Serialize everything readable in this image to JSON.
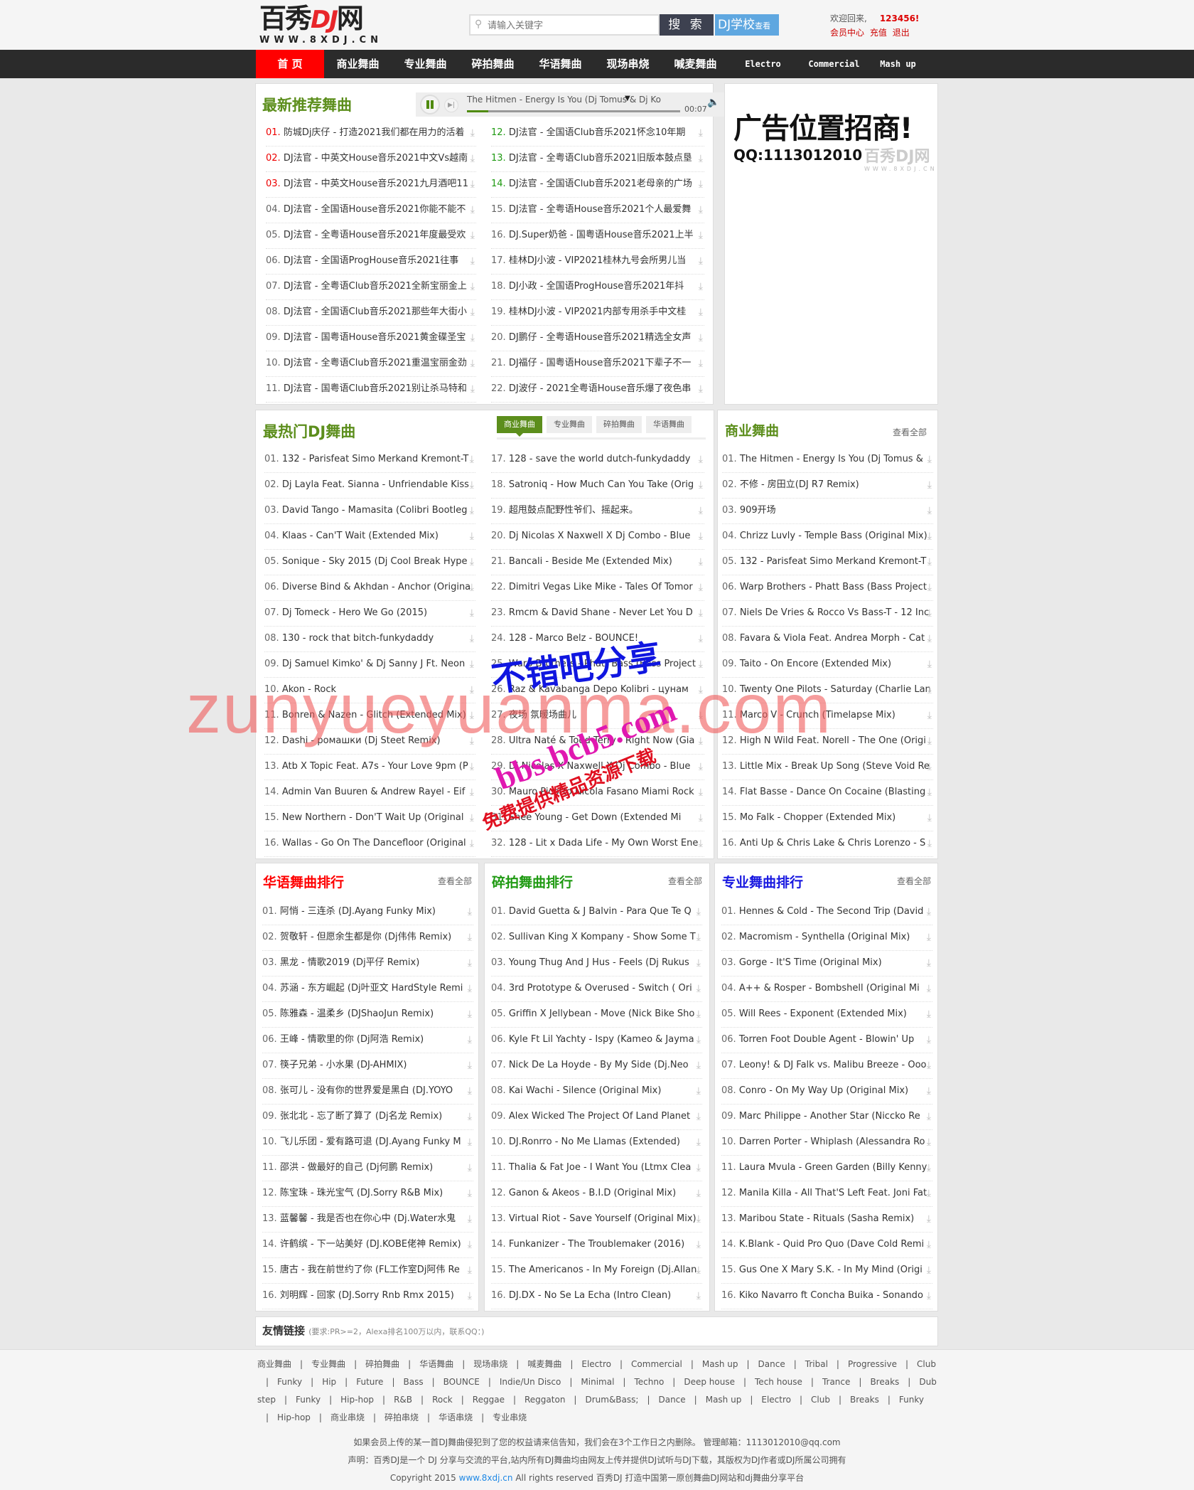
{
  "header": {
    "logo_cn": "百秀",
    "logo_dj": "DJ",
    "logo_net": "网",
    "logo_url": "WWW.8XDJ.CN",
    "search_placeholder": "请输入关键字",
    "search_button": "搜 索",
    "dj_school": "DJ学校",
    "dj_school_view": "查看",
    "welcome": "欢迎回来,",
    "username": "123456!",
    "member_center": "会员中心",
    "recharge": "充值",
    "logout": "退出"
  },
  "nav": [
    "首 页",
    "商业舞曲",
    "专业舞曲",
    "碎拍舞曲",
    "华语舞曲",
    "现场串烧",
    "喊麦舞曲",
    "Electro",
    "Commercial",
    "Mash up"
  ],
  "latest": {
    "title": "最新推荐舞曲",
    "player": {
      "track": "The Hitmen - Energy Is You (Dj Tomus & Dj Ko",
      "time": "00:07",
      "progress": 0.1
    },
    "left": [
      {
        "n": "01.",
        "t": "防城Dj庆仔 - 打造2021我们都在用力的活着"
      },
      {
        "n": "02.",
        "t": "DJ法官 - 中英文House音乐2021中文Vs越南"
      },
      {
        "n": "03.",
        "t": "DJ法官 - 中英文House音乐2021九月酒吧11"
      },
      {
        "n": "04.",
        "t": "DJ法官 - 全国语House音乐2021你能不能不"
      },
      {
        "n": "05.",
        "t": "DJ法官 - 全粤语House音乐2021年度最受欢"
      },
      {
        "n": "06.",
        "t": "DJ法官 - 全国语ProgHouse音乐2021往事"
      },
      {
        "n": "07.",
        "t": "DJ法官 - 全粤语Club音乐2021全新宝丽金上"
      },
      {
        "n": "08.",
        "t": "DJ法官 - 全国语Club音乐2021那些年大街小"
      },
      {
        "n": "09.",
        "t": "DJ法官 - 国粤语House音乐2021黄金碟圣宝"
      },
      {
        "n": "10.",
        "t": "DJ法官 - 全粤语Club音乐2021重温宝丽金劲"
      },
      {
        "n": "11.",
        "t": "DJ法官 - 国粤语Club音乐2021别让杀马特和"
      }
    ],
    "right": [
      {
        "n": "12.",
        "t": "DJ法官 - 全国语Club音乐2021怀念10年期"
      },
      {
        "n": "13.",
        "t": "DJ法官 - 全粤语Club音乐2021旧版本鼓点垦"
      },
      {
        "n": "14.",
        "t": "DJ法官 - 全国语Club音乐2021老母亲的广场"
      },
      {
        "n": "15.",
        "t": "DJ法官 - 全粤语House音乐2021个人最爱舞"
      },
      {
        "n": "16.",
        "t": "DJ.Super奶爸 - 国粤语House音乐2021上半"
      },
      {
        "n": "17.",
        "t": "桂林DJ小波 - VIP2021桂林九号会所男儿当"
      },
      {
        "n": "18.",
        "t": "DJ小政 - 全国语ProgHouse音乐2021年抖"
      },
      {
        "n": "19.",
        "t": "桂林DJ小波 - VIP2021内部专用杀手中文桂"
      },
      {
        "n": "20.",
        "t": "DJ鹏仔 - 全粤语House音乐2021精选全女声"
      },
      {
        "n": "21.",
        "t": "DJ福仔 - 国粤语House音乐2021下辈子不一"
      },
      {
        "n": "22.",
        "t": "DJ波仔 - 2021全粤语House音乐爆了夜色串"
      }
    ]
  },
  "ad": {
    "headline": "广告位置招商!",
    "qq": "QQ:1113012010",
    "brand": "百秀DJ网",
    "brand_url": "WWW.8XDJ.CN"
  },
  "hot": {
    "title": "最热门DJ舞曲",
    "tabs": [
      "商业舞曲",
      "专业舞曲",
      "碎拍舞曲",
      "华语舞曲"
    ],
    "left": [
      {
        "n": "01.",
        "t": "132 - Parisfeat Simo Merkand Kremont-T"
      },
      {
        "n": "02.",
        "t": "Dj Layla Feat. Sianna - Unfriendable Kiss"
      },
      {
        "n": "03.",
        "t": "David Tango - Mamasita (Colibri Bootleg"
      },
      {
        "n": "04.",
        "t": "Klaas - Can'T Wait (Extended Mix)"
      },
      {
        "n": "05.",
        "t": "Sonique - Sky 2015 (Dj Cool Break Hype"
      },
      {
        "n": "06.",
        "t": "Diverse Bind & Akhdan - Anchor (Origina"
      },
      {
        "n": "07.",
        "t": "Dj Tomeck - Hero We Go (2015)"
      },
      {
        "n": "08.",
        "t": "130 - rock that bitch-funkydaddy"
      },
      {
        "n": "09.",
        "t": "Dj Samuel Kimko' & Dj Sanny J Ft. Neon"
      },
      {
        "n": "10.",
        "t": "Akon - Rock"
      },
      {
        "n": "11.",
        "t": "Bonren & Nazen - Glitch (Extended Mix)"
      },
      {
        "n": "12.",
        "t": "Dashi - ромашки (Dj Steet Remix)"
      },
      {
        "n": "13.",
        "t": "Atb X Topic Feat. A7s - Your Love 9pm (P"
      },
      {
        "n": "14.",
        "t": "Admin Van Buuren & Andrew Rayel - Eif"
      },
      {
        "n": "15.",
        "t": "New Northern - Don'T Wait Up (Original"
      },
      {
        "n": "16.",
        "t": "Wallas - Go On The Dancefloor (Original"
      }
    ],
    "right": [
      {
        "n": "17.",
        "t": "128 - save the world dutch-funkydaddy"
      },
      {
        "n": "18.",
        "t": "Satroniq - How Much Can You Take (Orig"
      },
      {
        "n": "19.",
        "t": "超甩鼓点配野性爷们、摇起来。"
      },
      {
        "n": "20.",
        "t": "Dj Nicolas X Naxwell X Dj Combo - Blue"
      },
      {
        "n": "21.",
        "t": "Bancali - Beside Me (Extended Mix)"
      },
      {
        "n": "22.",
        "t": "Dimitri Vegas Like Mike - Tales Of Tomor"
      },
      {
        "n": "23.",
        "t": "Rmcm & David Shane - Never Let You D"
      },
      {
        "n": "24.",
        "t": "128 - Marco Belz - BOUNCE!"
      },
      {
        "n": "25.",
        "t": "Warp Brothers - Phatt Bass (Bass Project"
      },
      {
        "n": "26.",
        "t": "Raz & Kavabanga Depo Kolibri - цунам"
      },
      {
        "n": "27.",
        "t": "夜场 氛暖场曲儿"
      },
      {
        "n": "28.",
        "t": "Ultra Naté & Todd Terry - Right Now (Gia"
      },
      {
        "n": "29.",
        "t": "Dj Nicolas X Naxwell X Dj Combo - Blue"
      },
      {
        "n": "30.",
        "t": "Mauro Picotto Nicola Fasano Miami Rock"
      },
      {
        "n": "31.",
        "t": "Shee Young - Get Down (Extended Mi"
      },
      {
        "n": "32.",
        "t": "128 - Lit x Dada Life - My Own Worst Ene"
      }
    ]
  },
  "commercial": {
    "title": "商业舞曲",
    "view_all": "查看全部",
    "items": [
      {
        "n": "01.",
        "t": "The Hitmen - Energy Is You (Dj Tomus &"
      },
      {
        "n": "02.",
        "t": "不修 - 房田立(DJ R7 Remix)"
      },
      {
        "n": "03.",
        "t": "909开场"
      },
      {
        "n": "04.",
        "t": "Chrizz Luvly - Temple Bass (Original Mix)"
      },
      {
        "n": "05.",
        "t": "132 - Parisfeat Simo Merkand Kremont-T"
      },
      {
        "n": "06.",
        "t": "Warp Brothers - Phatt Bass (Bass Project"
      },
      {
        "n": "07.",
        "t": "Niels De Vries & Rocco Vs Bass-T - 12 Inc"
      },
      {
        "n": "08.",
        "t": "Favara & Viola Feat. Andrea Morph - Cat"
      },
      {
        "n": "09.",
        "t": "Taito - On Encore (Extended Mix)"
      },
      {
        "n": "10.",
        "t": "Twenty One Pilots - Saturday (Charlie Lan"
      },
      {
        "n": "11.",
        "t": "Marco V - Crunch (Timelapse Mix)"
      },
      {
        "n": "12.",
        "t": "High N Wild Feat. Norell - The One (Origi"
      },
      {
        "n": "13.",
        "t": "Little Mix - Break Up Song (Steve Void Re"
      },
      {
        "n": "14.",
        "t": "Flat Basse - Dance On Cocaine (Blasting"
      },
      {
        "n": "15.",
        "t": "Mo Falk - Chopper (Extended Mix)"
      },
      {
        "n": "16.",
        "t": "Anti Up & Chris Lake & Chris Lorenzo - S"
      }
    ]
  },
  "chinese": {
    "title": "华语舞曲排行",
    "view_all": "查看全部",
    "items": [
      {
        "n": "01.",
        "t": "阿悄 - 三连杀 (DJ.Ayang Funky Mix)"
      },
      {
        "n": "02.",
        "t": "贺敬轩 - 但愿余生都是你 (Dj伟伟 Remix)"
      },
      {
        "n": "03.",
        "t": "黑龙 - 情歌2019 (Dj平仔 Remix)"
      },
      {
        "n": "04.",
        "t": "苏涵 - 东方崛起 (Dj叶亚文 HardStyle Remi"
      },
      {
        "n": "05.",
        "t": "陈雅森 - 温柔乡 (DJShaoJun Remix)"
      },
      {
        "n": "06.",
        "t": "王峰 - 情歌里的你 (Dj阿浩 Remix)"
      },
      {
        "n": "07.",
        "t": "筷子兄弟 - 小水果 (DJ-AHMIX)"
      },
      {
        "n": "08.",
        "t": "张可儿 - 没有你的世界爱是黑白 (DJ.YOYO"
      },
      {
        "n": "09.",
        "t": "张北北 - 忘了断了算了 (Dj名龙 Remix)"
      },
      {
        "n": "10.",
        "t": "飞儿乐团 - 爱有路可退 (DJ.Ayang Funky M"
      },
      {
        "n": "11.",
        "t": "邵洪 - 做最好的自己 (Dj何鹏 Remix)"
      },
      {
        "n": "12.",
        "t": "陈宝珠 - 珠光宝气 (DJ.Sorry R&B Mix)"
      },
      {
        "n": "13.",
        "t": "蓝馨馨 - 我是否也在你心中 (Dj.Water水鬼"
      },
      {
        "n": "14.",
        "t": "许鹤缤 - 下一站美好 (DJ.KOBE佬神 Remix)"
      },
      {
        "n": "15.",
        "t": "唐古 - 我在前世约了你 (FL工作室Dj阿伟 Re"
      },
      {
        "n": "16.",
        "t": "刘明辉 - 回家 (DJ.Sorry Rnb Rmx 2015)"
      }
    ]
  },
  "breakbeat": {
    "title": "碎拍舞曲排行",
    "view_all": "查看全部",
    "items": [
      {
        "n": "01.",
        "t": "David Guetta & J Balvin - Para Que Te Q"
      },
      {
        "n": "02.",
        "t": "Sullivan King X Kompany - Show Some T"
      },
      {
        "n": "03.",
        "t": "Young Thug And J Hus - Feels (Dj Rukus"
      },
      {
        "n": "04.",
        "t": "3rd Prototype & Overused - Switch ( Ori"
      },
      {
        "n": "05.",
        "t": "Griffin X Jellybean - Move (Nick Bike Sho"
      },
      {
        "n": "06.",
        "t": "Kyle Ft Lil Yachty - Ispy (Kameo & Jayma"
      },
      {
        "n": "07.",
        "t": "Nick De La Hoyde - By My Side (Dj.Neo"
      },
      {
        "n": "08.",
        "t": "Kai Wachi - Silence (Original Mix)"
      },
      {
        "n": "09.",
        "t": "Alex Wicked The Project Of Land Planet"
      },
      {
        "n": "10.",
        "t": "DJ.Ronrro - No Me Llamas (Extended)"
      },
      {
        "n": "11.",
        "t": "Thalia & Fat Joe - I Want You (Ltmx Clea"
      },
      {
        "n": "12.",
        "t": "Ganon & Akeos - B.I.D (Original Mix)"
      },
      {
        "n": "13.",
        "t": "Virtual Riot - Save Yourself (Original Mix)"
      },
      {
        "n": "14.",
        "t": "Funkanizer - The Troublemaker (2016)"
      },
      {
        "n": "15.",
        "t": "The Americanos - In My Foreign (Dj.Allan"
      },
      {
        "n": "16.",
        "t": "DJ.DX - No Se La Echa (Intro Clean)"
      }
    ]
  },
  "pro": {
    "title": "专业舞曲排行",
    "view_all": "查看全部",
    "items": [
      {
        "n": "01.",
        "t": "Hennes & Cold - The Second Trip (David"
      },
      {
        "n": "02.",
        "t": "Macromism - Synthella (Original Mix)"
      },
      {
        "n": "03.",
        "t": "Gorge - It'S Time (Original Mix)"
      },
      {
        "n": "04.",
        "t": "A++ & Rosper - Bombshell (Original Mi"
      },
      {
        "n": "05.",
        "t": "Will Rees - Exponent (Extended Mix)"
      },
      {
        "n": "06.",
        "t": "Torren Foot Double Agent - Blowin' Up"
      },
      {
        "n": "07.",
        "t": "Leony! & DJ Falk vs. Malibu Breeze - Ooo"
      },
      {
        "n": "08.",
        "t": "Conro - On My Way Up (Original Mix)"
      },
      {
        "n": "09.",
        "t": "Marc Philippe - Another Star (Niccko Re"
      },
      {
        "n": "10.",
        "t": "Darren Porter - Whiplash (Alessandra Ro"
      },
      {
        "n": "11.",
        "t": "Laura Mvula - Green Garden (Billy Kenny"
      },
      {
        "n": "12.",
        "t": "Manila Killa - All That'S Left Feat. Joni Fat"
      },
      {
        "n": "13.",
        "t": "Maribou State - Rituals (Sasha Remix)"
      },
      {
        "n": "14.",
        "t": "K.Blank - Quid Pro Quo (Dave Cold Remi"
      },
      {
        "n": "15.",
        "t": "Gus One X Mary S.K. - In My Mind (Origi"
      },
      {
        "n": "16.",
        "t": "Kiko Navarro ft Concha Buika - Sonando"
      }
    ]
  },
  "friend_links": {
    "title": "友情链接",
    "note": "(要求:PR>=2，Alexa排名100万以内，联系QQ：)"
  },
  "footer": {
    "tags": [
      "商业舞曲",
      "专业舞曲",
      "碎拍舞曲",
      "华语舞曲",
      "现场串烧",
      "喊麦舞曲",
      "Electro",
      "Commercial",
      "Mash up",
      "Dance",
      "Tribal",
      "Progressive",
      "Club",
      "Funky",
      "Hip",
      "Future",
      "Bass",
      "BOUNCE",
      "Indie/Un Disco",
      "Minimal",
      "Techno",
      "Deep house",
      "Tech house",
      "Trance",
      "Breaks",
      "Dubstep",
      "Funky",
      "Hip-hop",
      "R&B",
      "Rock",
      "Reggae",
      "Reggaton",
      "Drum&Bass;",
      "Dance",
      "Mash up",
      "Electro",
      "Club",
      "Breaks",
      "Funky",
      "Hip-hop",
      "商业串烧",
      "碎拍串烧",
      "华语串烧",
      "专业串烧"
    ],
    "notice": "如果会员上传的某一首DJ舞曲侵犯到了您的权益请来信告知，我们会在3个工作日之内删除。 管理邮箱：1113012010@qq.com",
    "statement": "声明：百秀DJ是一个 DJ 分享与交流的平台,站内所有DJ舞曲均由网友上传并提供DJ试听与DJ下载，其版权为DJ作者或DJ所属公司拥有",
    "copyright_pre": "Copyright 2015 ",
    "copyright_link": "www.8xdj.cn",
    "copyright_post": " All rights reserved 百秀DJ 打造中国第一原创舞曲DJ网站和dj舞曲分享平台"
  },
  "watermarks": {
    "w1": "zunyueyuanma.com",
    "w2": "不错吧分享",
    "w3": "bbs.bcb5.com",
    "w4": "免费提供精品资源下载"
  }
}
